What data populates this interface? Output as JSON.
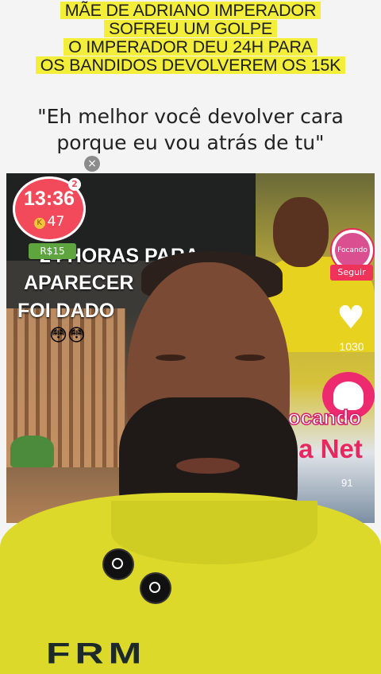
{
  "headline": [
    "MÃE DE ADRIANO IMPERADOR",
    "SOFREU UM GOLPE",
    "O IMPERADOR DEU 24H PARA",
    "OS BANDIDOS DEVOLVEREM OS 15K"
  ],
  "quote": [
    "\"Eh melhor você devolver cara",
    "porque eu vou atrás de tu\""
  ],
  "close_icon": "×",
  "live": {
    "time": "13:36",
    "coins": "47",
    "badge": "2",
    "money_tag": "R$15"
  },
  "cover_text": {
    "line1": "24 HORAS PARA",
    "line2": "APARECER",
    "line3": "FOI DADO",
    "emojis": "😳😳"
  },
  "sidebar": {
    "channel_label": "Focando na Net",
    "follow": "Seguir",
    "likes": "1030",
    "views": "91"
  },
  "brand": {
    "line1": "focando",
    "line2": "na Net"
  },
  "colors": {
    "highlight": "#f3ee3a",
    "live_red": "#f24a5a",
    "brand_pink": "#e8265f",
    "shirt_yellow": "#dcd92a"
  },
  "chest": "FRM"
}
